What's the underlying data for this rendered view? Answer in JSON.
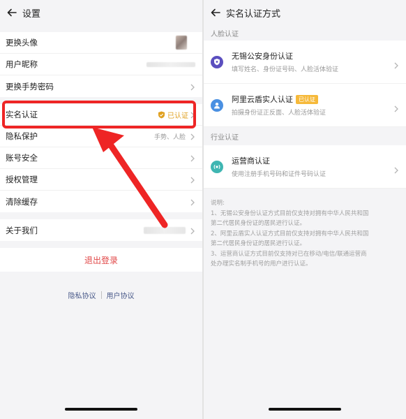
{
  "settings": {
    "title": "设置",
    "group1": [
      {
        "label": "更换头像"
      },
      {
        "label": "用户昵称"
      },
      {
        "label": "更换手势密码"
      }
    ],
    "group2": [
      {
        "label": "实名认证",
        "status": "已认证"
      },
      {
        "label": "隐私保护",
        "value": "手势、人脸"
      },
      {
        "label": "账号安全"
      },
      {
        "label": "授权管理"
      },
      {
        "label": "清除缓存"
      }
    ],
    "about": {
      "label": "关于我们"
    },
    "logout": "退出登录",
    "links": {
      "privacy": "隐私协议",
      "user": "用户协议"
    }
  },
  "verify": {
    "title": "实名认证方式",
    "section1": "人脸认证",
    "methods1": [
      {
        "title": "无锡公安身份认证",
        "desc": "填写姓名、身份证号码、人脸活体验证",
        "icon": "shield-icon",
        "color": "#5b4fbf"
      },
      {
        "title": "阿里云盾实人认证",
        "badge": "已认证",
        "desc": "拍摄身份证正反面、人脸活体验证",
        "icon": "person-icon",
        "color": "#4a90e2"
      }
    ],
    "section2": "行业认证",
    "methods2": [
      {
        "title": "运营商认证",
        "desc": "使用注册手机号码和证件号码认证",
        "icon": "signal-icon",
        "color": "#3fb6b2"
      }
    ],
    "note_lines": [
      "说明:",
      "1、无锡公安身份认证方式目前仅支持对拥有中华人民共和国",
      "第二代居民身份证的居民进行认证。",
      "2、阿里云盾实人认证方式目前仅支持对拥有中华人民共和国",
      "第二代居民身份证的居民进行认证。",
      "3、运营商认证方式目前仅支持对已在移动/电信/联通运营商",
      "处办理实名制手机号的用户进行认证。"
    ]
  },
  "colors": {
    "highlight": "#ee2525",
    "verified": "#e0a01f",
    "badge": "#f6b93a",
    "logout": "#e14848"
  }
}
